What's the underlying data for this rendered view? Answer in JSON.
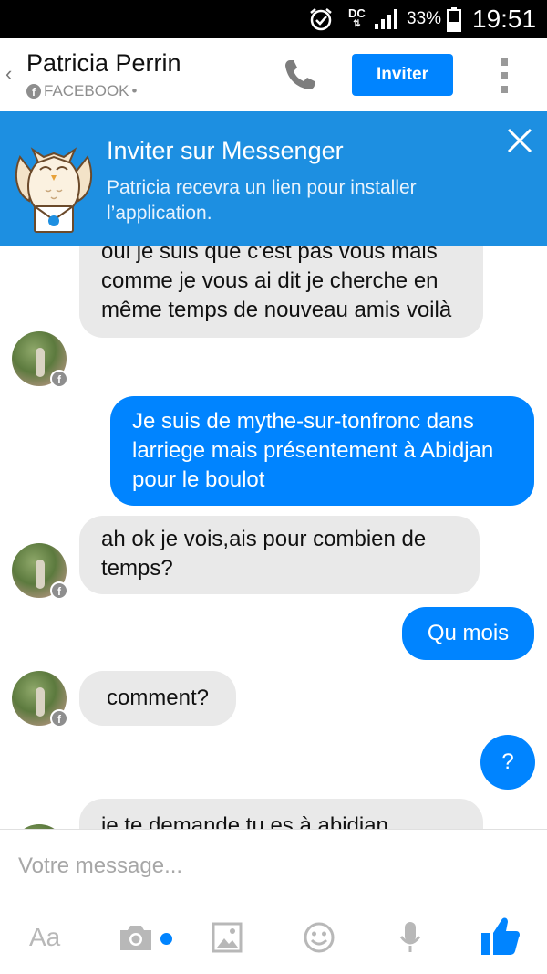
{
  "status_bar": {
    "network_label": "DC",
    "battery_percent": "33%",
    "time": "19:51"
  },
  "header": {
    "contact_name": "Patricia Perrin",
    "source": "FACEBOOK",
    "source_suffix": "•",
    "invite_label": "Inviter"
  },
  "banner": {
    "title": "Inviter sur Messenger",
    "body": "Patricia recevra un lien pour installer l’application."
  },
  "messages": [
    {
      "from": "them",
      "text": "oui je suis que c'est pas vous mais comme je vous ai dit je cherche en même temps de nouveau amis voilà"
    },
    {
      "from": "me",
      "text": "Je suis de mythe-sur-tonfronc dans larriege mais présentement à Abidjan pour le boulot"
    },
    {
      "from": "them",
      "text": "ah ok je vois,ais pour combien de temps?"
    },
    {
      "from": "me",
      "text": "Qu mois"
    },
    {
      "from": "them",
      "text": "comment?"
    },
    {
      "from": "me",
      "text": "?"
    },
    {
      "from": "them",
      "text": "je te demande tu es à abidjan"
    }
  ],
  "composer": {
    "placeholder": "Votre message...",
    "text_tool_label": "Aa"
  },
  "icons": {
    "alarm": "alarm-clock-icon",
    "signal": "signal-bars-icon",
    "battery": "battery-icon",
    "back": "chevron-left-icon",
    "phone": "phone-icon",
    "more": "more-vertical-icon",
    "owl": "owl-mascot-icon",
    "close": "close-icon",
    "camera": "camera-icon",
    "gallery": "image-icon",
    "emoji": "smiley-icon",
    "mic": "microphone-icon",
    "like": "thumbs-up-icon"
  },
  "colors": {
    "accent": "#0084ff",
    "banner": "#1d8fe1",
    "incoming_bubble": "#e9e9e9"
  }
}
